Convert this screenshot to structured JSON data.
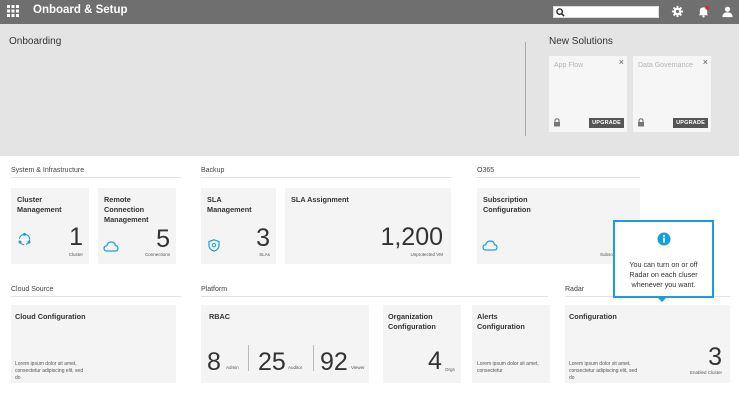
{
  "header": {
    "title": "Onboard & Setup",
    "search_placeholder": "",
    "icons": [
      "apps-grid-icon",
      "search-icon",
      "gear-icon",
      "bell-icon",
      "user-icon"
    ]
  },
  "hero": {
    "onboarding_title": "Onboarding",
    "new_solutions_title": "New Solutions",
    "solutions": [
      {
        "name": "App Flow",
        "close": "×",
        "upgrade": "UPGRADE"
      },
      {
        "name": "Data Governance",
        "close": "×",
        "upgrade": "UPGRADE"
      }
    ]
  },
  "sections": {
    "system": "System & Infrastructure",
    "backup": "Backup",
    "o365": "O365",
    "cloud_source": "Cloud Source",
    "platform": "Platform",
    "radar": "Radar"
  },
  "cards": {
    "cluster": {
      "title": "Cluster Management",
      "value": "1",
      "unit": "Cluster"
    },
    "remote": {
      "title": "Remote Connection Management",
      "value": "5",
      "unit": "Connections"
    },
    "sla_mgmt": {
      "title": "SLA Management",
      "value": "3",
      "unit": "SLAs"
    },
    "sla_assign": {
      "title": "SLA Assignment",
      "value": "1,200",
      "unit": "Unprotected VM"
    },
    "subscription": {
      "title": "Subscription Configuration",
      "unit": "Subscr"
    },
    "cloud_config": {
      "title": "Cloud Configuration",
      "lorem": "Lorem ipsum dolor sit amet, consectetur adipiscing elit, sed do"
    },
    "rbac": {
      "title": "RBAC",
      "admin_value": "8",
      "admin_label": "Admin",
      "auditor_value": "25",
      "auditor_label": "Auditor",
      "viewer_value": "92",
      "viewer_label": "Viewer"
    },
    "org": {
      "title": "Organization Configuration",
      "value": "4",
      "unit": "Orgs"
    },
    "alerts": {
      "title": "Alerts Configuration",
      "lorem": "Lorem ipsum dolor sit amet, consectetur"
    },
    "radar": {
      "title": "Configuration",
      "lorem": "Lorem ipsum dolor sit amet, consectetur adipiscing elit, sed do",
      "value": "3",
      "unit": "Enabled Cluster"
    }
  },
  "tooltip": {
    "icon": "info-icon",
    "text": "You can turn on or off Radar on each cluser whenever you want."
  },
  "colors": {
    "accent": "#1aa0d8",
    "topbar": "#6f6f6f",
    "hero_bg": "#e4e4e4",
    "card_bg": "#f4f4f4",
    "notification": "#e8242e"
  }
}
